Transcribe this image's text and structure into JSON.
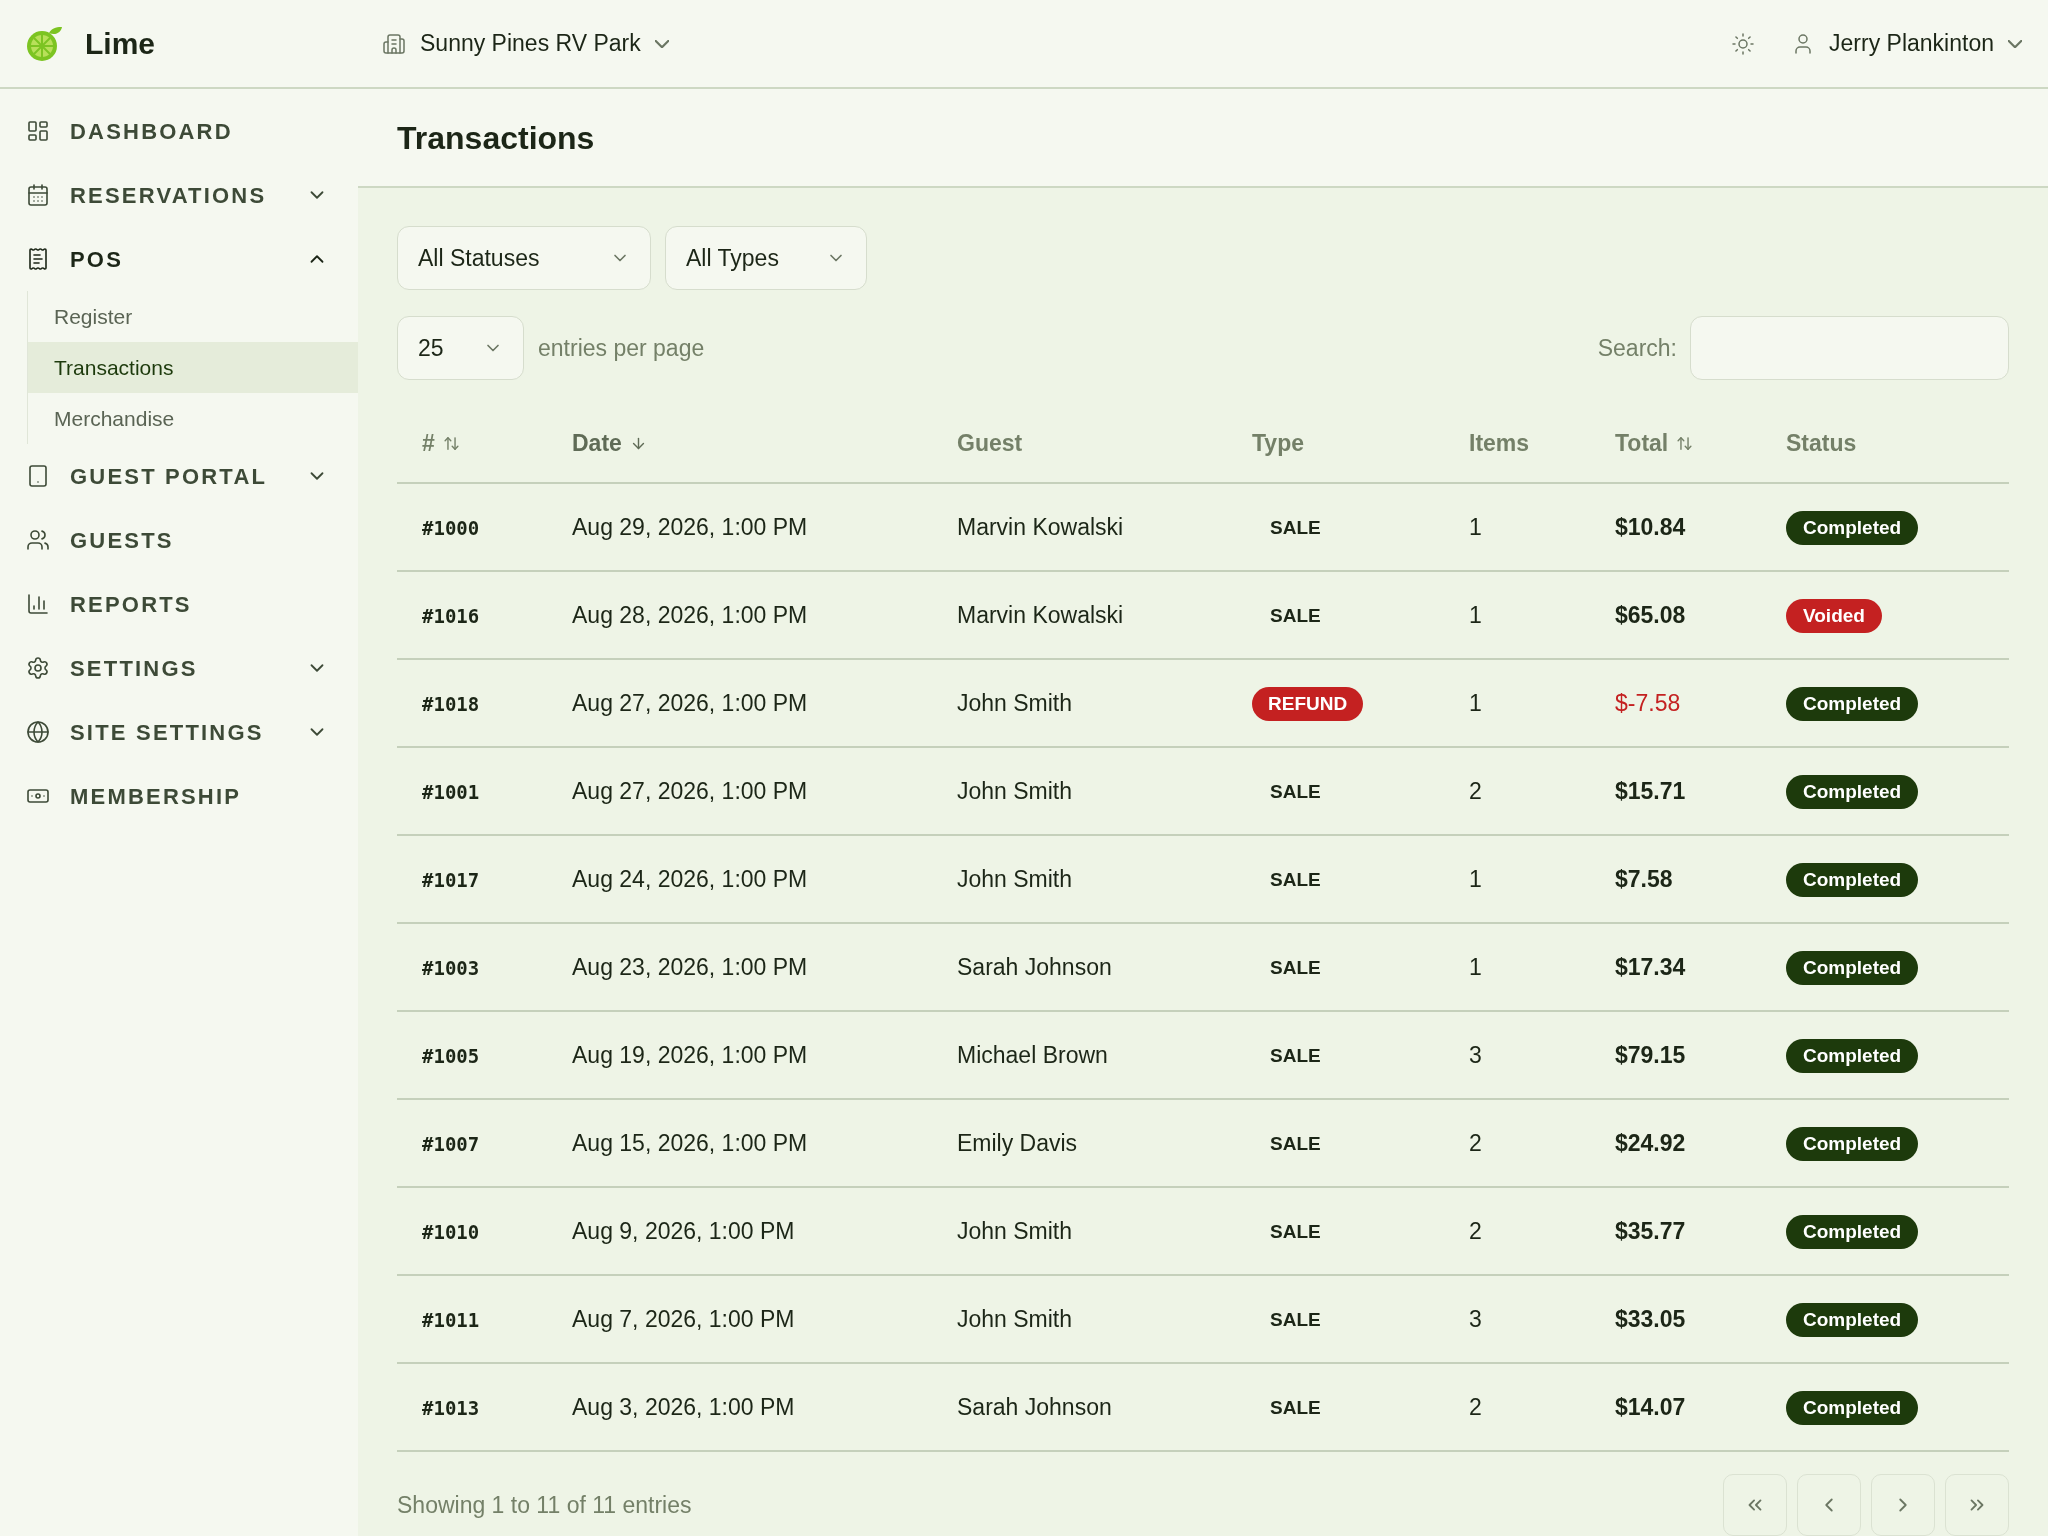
{
  "brand": {
    "name": "Lime"
  },
  "header": {
    "property": "Sunny Pines RV Park",
    "user": "Jerry Plankinton"
  },
  "sidebar": {
    "items": [
      {
        "label": "DASHBOARD"
      },
      {
        "label": "RESERVATIONS",
        "expanded": false
      },
      {
        "label": "POS",
        "expanded": true,
        "children": [
          {
            "label": "Register",
            "selected": false
          },
          {
            "label": "Transactions",
            "selected": true
          },
          {
            "label": "Merchandise",
            "selected": false
          }
        ]
      },
      {
        "label": "GUEST PORTAL",
        "expanded": false
      },
      {
        "label": "GUESTS"
      },
      {
        "label": "REPORTS"
      },
      {
        "label": "SETTINGS",
        "expanded": false
      },
      {
        "label": "SITE SETTINGS",
        "expanded": false
      },
      {
        "label": "MEMBERSHIP"
      }
    ]
  },
  "page": {
    "title": "Transactions"
  },
  "filters": [
    {
      "value": "All Statuses"
    },
    {
      "value": "All Types"
    }
  ],
  "page_size": {
    "value": "25",
    "label": "entries per page"
  },
  "search": {
    "label": "Search:"
  },
  "table": {
    "columns": [
      {
        "label": "#",
        "sortable": true,
        "sorted_descending": false
      },
      {
        "label": "Date",
        "sortable": true,
        "sorted_descending": true
      },
      {
        "label": "Guest"
      },
      {
        "label": "Type"
      },
      {
        "label": "Items"
      },
      {
        "label": "Total",
        "sortable": true,
        "sorted_descending": false
      },
      {
        "label": "Status"
      }
    ],
    "rows": [
      {
        "id": "#1000",
        "date": "Aug 29, 2026, 1:00 PM",
        "guest": "Marvin Kowalski",
        "type": {
          "kind": "sale",
          "label": "SALE"
        },
        "items": "1",
        "total": "$10.84",
        "status": {
          "kind": "completed",
          "label": "Completed"
        }
      },
      {
        "id": "#1016",
        "date": "Aug 28, 2026, 1:00 PM",
        "guest": "Marvin Kowalski",
        "type": {
          "kind": "sale",
          "label": "SALE"
        },
        "items": "1",
        "total": "$65.08",
        "status": {
          "kind": "voided",
          "label": "Voided"
        }
      },
      {
        "id": "#1018",
        "date": "Aug 27, 2026, 1:00 PM",
        "guest": "John Smith",
        "type": {
          "kind": "refund",
          "label": "REFUND"
        },
        "items": "1",
        "total": "$-7.58",
        "status": {
          "kind": "completed",
          "label": "Completed"
        }
      },
      {
        "id": "#1001",
        "date": "Aug 27, 2026, 1:00 PM",
        "guest": "John Smith",
        "type": {
          "kind": "sale",
          "label": "SALE"
        },
        "items": "2",
        "total": "$15.71",
        "status": {
          "kind": "completed",
          "label": "Completed"
        }
      },
      {
        "id": "#1017",
        "date": "Aug 24, 2026, 1:00 PM",
        "guest": "John Smith",
        "type": {
          "kind": "sale",
          "label": "SALE"
        },
        "items": "1",
        "total": "$7.58",
        "status": {
          "kind": "completed",
          "label": "Completed"
        }
      },
      {
        "id": "#1003",
        "date": "Aug 23, 2026, 1:00 PM",
        "guest": "Sarah Johnson",
        "type": {
          "kind": "sale",
          "label": "SALE"
        },
        "items": "1",
        "total": "$17.34",
        "status": {
          "kind": "completed",
          "label": "Completed"
        }
      },
      {
        "id": "#1005",
        "date": "Aug 19, 2026, 1:00 PM",
        "guest": "Michael Brown",
        "type": {
          "kind": "sale",
          "label": "SALE"
        },
        "items": "3",
        "total": "$79.15",
        "status": {
          "kind": "completed",
          "label": "Completed"
        }
      },
      {
        "id": "#1007",
        "date": "Aug 15, 2026, 1:00 PM",
        "guest": "Emily Davis",
        "type": {
          "kind": "sale",
          "label": "SALE"
        },
        "items": "2",
        "total": "$24.92",
        "status": {
          "kind": "completed",
          "label": "Completed"
        }
      },
      {
        "id": "#1010",
        "date": "Aug 9, 2026, 1:00 PM",
        "guest": "John Smith",
        "type": {
          "kind": "sale",
          "label": "SALE"
        },
        "items": "2",
        "total": "$35.77",
        "status": {
          "kind": "completed",
          "label": "Completed"
        }
      },
      {
        "id": "#1011",
        "date": "Aug 7, 2026, 1:00 PM",
        "guest": "John Smith",
        "type": {
          "kind": "sale",
          "label": "SALE"
        },
        "items": "3",
        "total": "$33.05",
        "status": {
          "kind": "completed",
          "label": "Completed"
        }
      },
      {
        "id": "#1013",
        "date": "Aug 3, 2026, 1:00 PM",
        "guest": "Sarah Johnson",
        "type": {
          "kind": "sale",
          "label": "SALE"
        },
        "items": "2",
        "total": "$14.07",
        "status": {
          "kind": "completed",
          "label": "Completed"
        }
      }
    ]
  },
  "footer": {
    "summary": "Showing 1 to 11 of 11 entries"
  }
}
